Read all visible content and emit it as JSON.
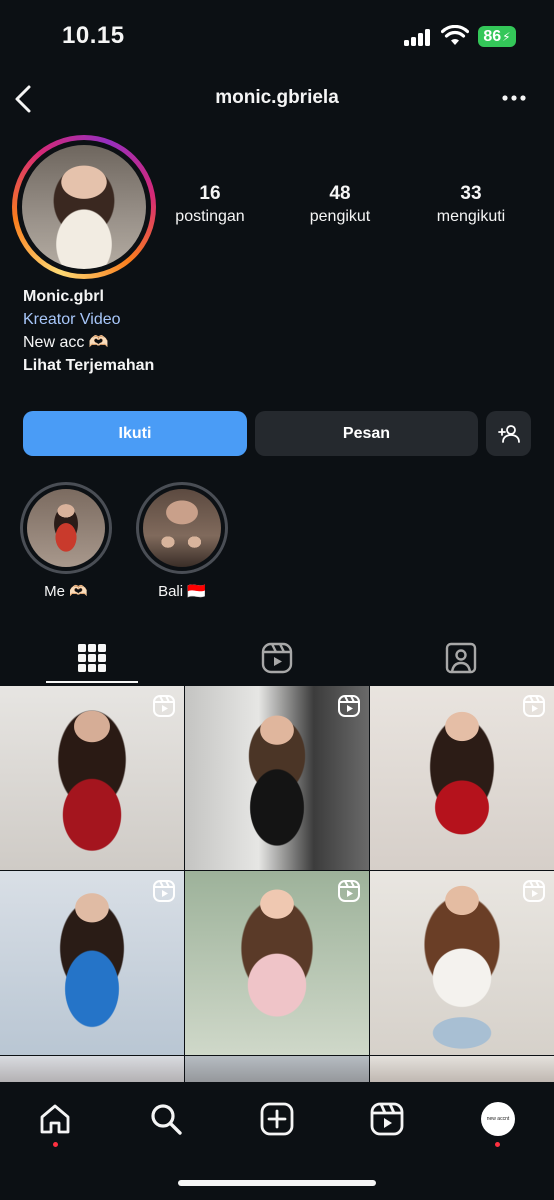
{
  "status_bar": {
    "time": "10.15",
    "battery": "86",
    "icons": [
      "signal-icon",
      "wifi-icon",
      "battery-icon"
    ]
  },
  "header": {
    "username": "monic.gbriela",
    "icons": [
      "back-icon",
      "more-icon"
    ]
  },
  "profile": {
    "stats": [
      {
        "num": "16",
        "label": "postingan"
      },
      {
        "num": "48",
        "label": "pengikut"
      },
      {
        "num": "33",
        "label": "mengikuti"
      }
    ],
    "name": "Monic.gbrl",
    "category": "Kreator Video",
    "bio": "New acc 🫶🏻",
    "translate": "Lihat Terjemahan"
  },
  "buttons": {
    "follow": "Ikuti",
    "message": "Pesan",
    "add_user_icon": "add-user-icon"
  },
  "highlights": [
    {
      "label": "Me 🫶🏻"
    },
    {
      "label": "Bali 🇮🇩"
    }
  ],
  "tabs": [
    {
      "icon": "grid-icon",
      "active": true
    },
    {
      "icon": "reels-icon",
      "active": false
    },
    {
      "icon": "tagged-icon",
      "active": false
    }
  ],
  "posts": [
    {
      "type": "reel"
    },
    {
      "type": "reel"
    },
    {
      "type": "reel"
    },
    {
      "type": "reel"
    },
    {
      "type": "reel"
    },
    {
      "type": "reel"
    },
    {
      "type": "reel"
    },
    {
      "type": "reel"
    },
    {
      "type": "reel"
    }
  ],
  "bottom_nav": {
    "items": [
      "home-icon",
      "search-icon",
      "create-icon",
      "reels-icon",
      "profile-avatar"
    ],
    "avatar_text": "new accnt"
  },
  "colors": {
    "background": "#0c1014",
    "follow_button": "#4a9cf6",
    "secondary_button": "#25292e",
    "category_link": "#a8c7fa",
    "notification_dot": "#ff3040"
  }
}
